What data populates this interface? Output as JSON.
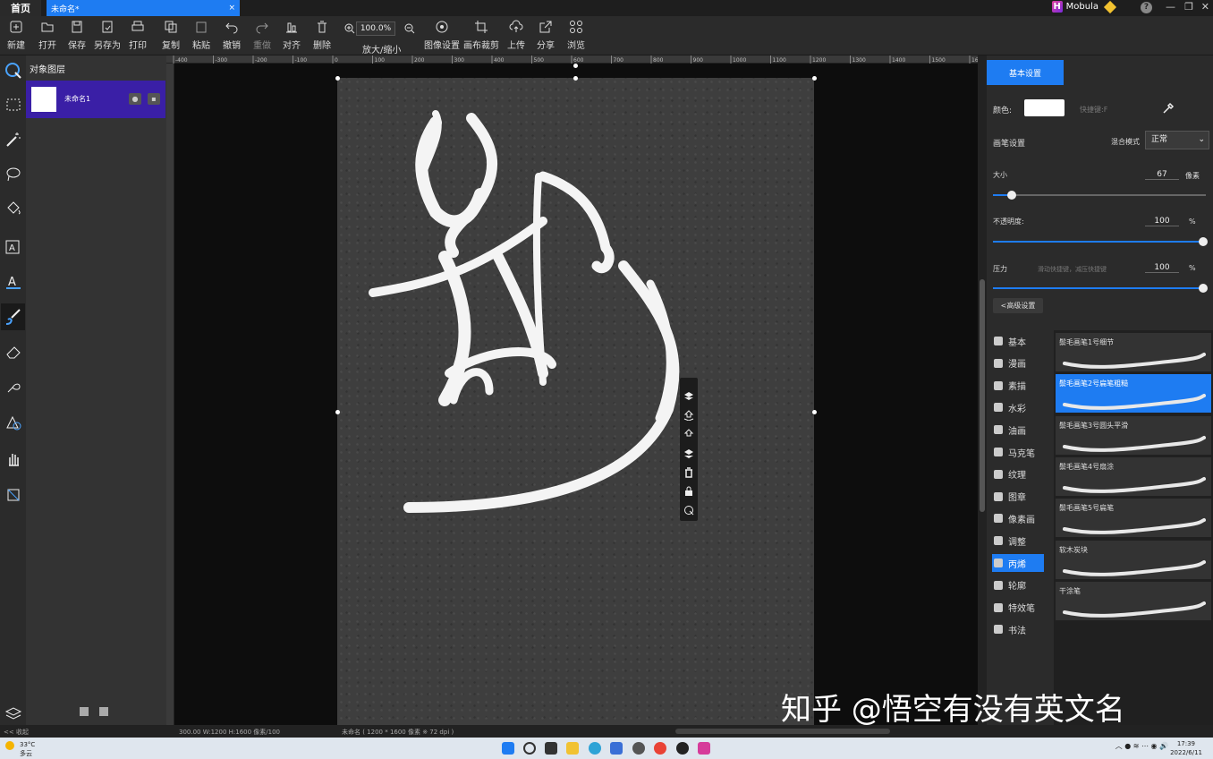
{
  "titlebar": {
    "home_tab": "首页",
    "doc_tab": "未命名*",
    "doc_close": "×",
    "brand_logo": "H",
    "brand_name": "Mobula",
    "help": "?",
    "minimize": "—",
    "restore": "❐",
    "close": "✕"
  },
  "toolbar": {
    "new": "新建",
    "open": "打开",
    "save": "保存",
    "save_as": "另存为",
    "print": "打印",
    "copy": "复制",
    "paste": "粘贴",
    "undo": "撤销",
    "redo": "重做",
    "align": "对齐",
    "delete": "删除",
    "zoom_value": "100.0%",
    "zoom_label": "放大/缩小",
    "image_settings": "图像设置",
    "canvas_crop": "画布裁剪",
    "upload": "上传",
    "share": "分享",
    "browse": "浏览"
  },
  "layers": {
    "title": "对象图层",
    "items": [
      {
        "name": "未命名1"
      }
    ],
    "footer_toggle": "<< 收起"
  },
  "ruler": {
    "top_ticks": [
      "-400",
      "-300",
      "-200",
      "-100",
      "0",
      "100",
      "200",
      "300",
      "400",
      "500",
      "600",
      "700",
      "800",
      "900",
      "1000",
      "1100",
      "1200",
      "1300",
      "1400",
      "1500",
      "1600"
    ],
    "expand": ">>"
  },
  "right_panel": {
    "tab_basic": "基本设置",
    "color_label": "颜色:",
    "color_hint": "快捷键:F",
    "brush_settings": "画笔设置",
    "blend_label": "混合模式",
    "blend_value": "正常",
    "size_label": "大小",
    "size_value": "67",
    "size_unit": "像素",
    "opacity_label": "不透明度:",
    "opacity_value": "100",
    "opacity_unit": "%",
    "pressure_label": "压力",
    "pressure_hint": "滑动快捷键，减压快捷键",
    "pressure_value": "100",
    "pressure_unit": "%",
    "advanced": "<高级设置",
    "categories": [
      "基本",
      "漫画",
      "素描",
      "水彩",
      "油画",
      "马克笔",
      "纹理",
      "图章",
      "像素画",
      "调整",
      "丙烯",
      "轮廓",
      "特效笔",
      "书法"
    ],
    "active_category": "丙烯",
    "brushes": [
      "鬃毛画笔1号细节",
      "鬃毛画笔2号扁笔粗糙",
      "鬃毛画笔3号圆头平滑",
      "鬃毛画笔4号扇涂",
      "鬃毛画笔5号扁笔",
      "软木炭块",
      "干涂笔"
    ],
    "active_brush": "鬃毛画笔2号扁笔粗糙"
  },
  "statusbar": {
    "left": "300.00 W:1200 H:1600 像素/100",
    "center": "未命名 ( 1200 * 1600 像素 ※ 72 dpi )"
  },
  "taskbar": {
    "weather_temp": "33°C",
    "weather_desc": "多云",
    "time": "17:39",
    "date": "2022/6/11"
  },
  "watermark": "知乎 @悟空有没有英文名",
  "colors": {
    "accent": "#1e7cf2",
    "layer_selected": "#3a1fa6",
    "canvas_bg": "#3e3e3e"
  }
}
